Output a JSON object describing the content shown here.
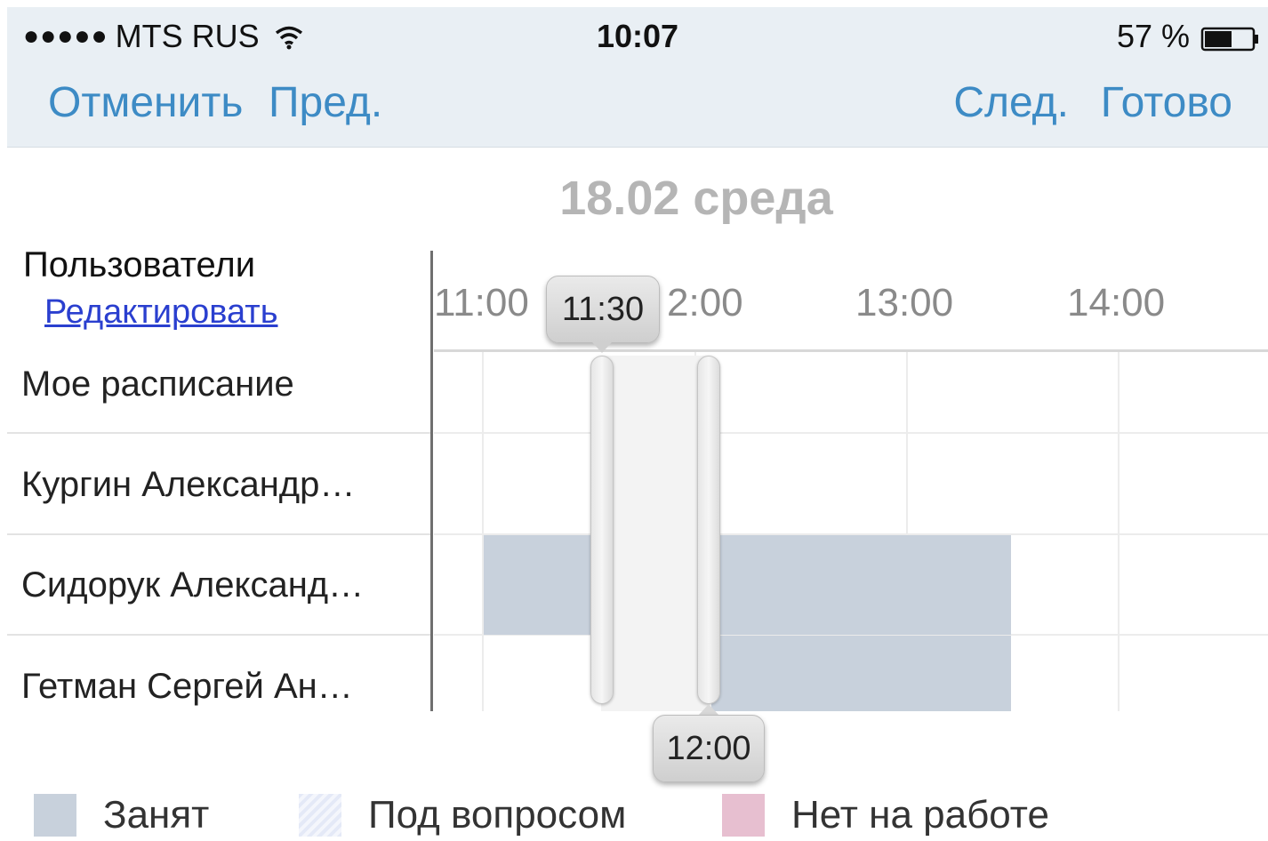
{
  "status_bar": {
    "carrier_signal": "●●●●●",
    "carrier": "MTS RUS",
    "time": "10:07",
    "battery": "57 %",
    "battery_level": 0.57
  },
  "nav": {
    "cancel": "Отменить",
    "prev": "Пред.",
    "next": "След.",
    "done": "Готово",
    "accent_color": "#3d8bc5"
  },
  "date_title": "18.02 среда",
  "users_header": "Пользователи",
  "edit_link": "Редактировать",
  "rows": [
    {
      "label": "Мое расписание"
    },
    {
      "label": "Кургин Александр…"
    },
    {
      "label": "Сидорук Александ…"
    },
    {
      "label": "Гетман Сергей Ан…"
    }
  ],
  "time_axis": [
    "11:00",
    "2:00",
    "13:00",
    "14:00"
  ],
  "selection": {
    "start": "11:30",
    "end": "12:00"
  },
  "busy_blocks": [
    {
      "row": "Сидорук Александ…",
      "start": "11:00",
      "end": "11:30",
      "status": "Занят"
    },
    {
      "row": "Сидорук Александ…",
      "start": "12:00",
      "end": "13:30",
      "status": "Занят"
    },
    {
      "row": "Гетман Сергей Ан…",
      "start": "12:00",
      "end": "13:30",
      "status": "Занят"
    }
  ],
  "legend": {
    "busy": {
      "label": "Занят",
      "color": "#c8d1dc"
    },
    "tentative": {
      "label": "Под вопросом",
      "color": "#e4e9f7"
    },
    "away": {
      "label": "Нет на работе",
      "color": "#e7bfd0"
    }
  }
}
